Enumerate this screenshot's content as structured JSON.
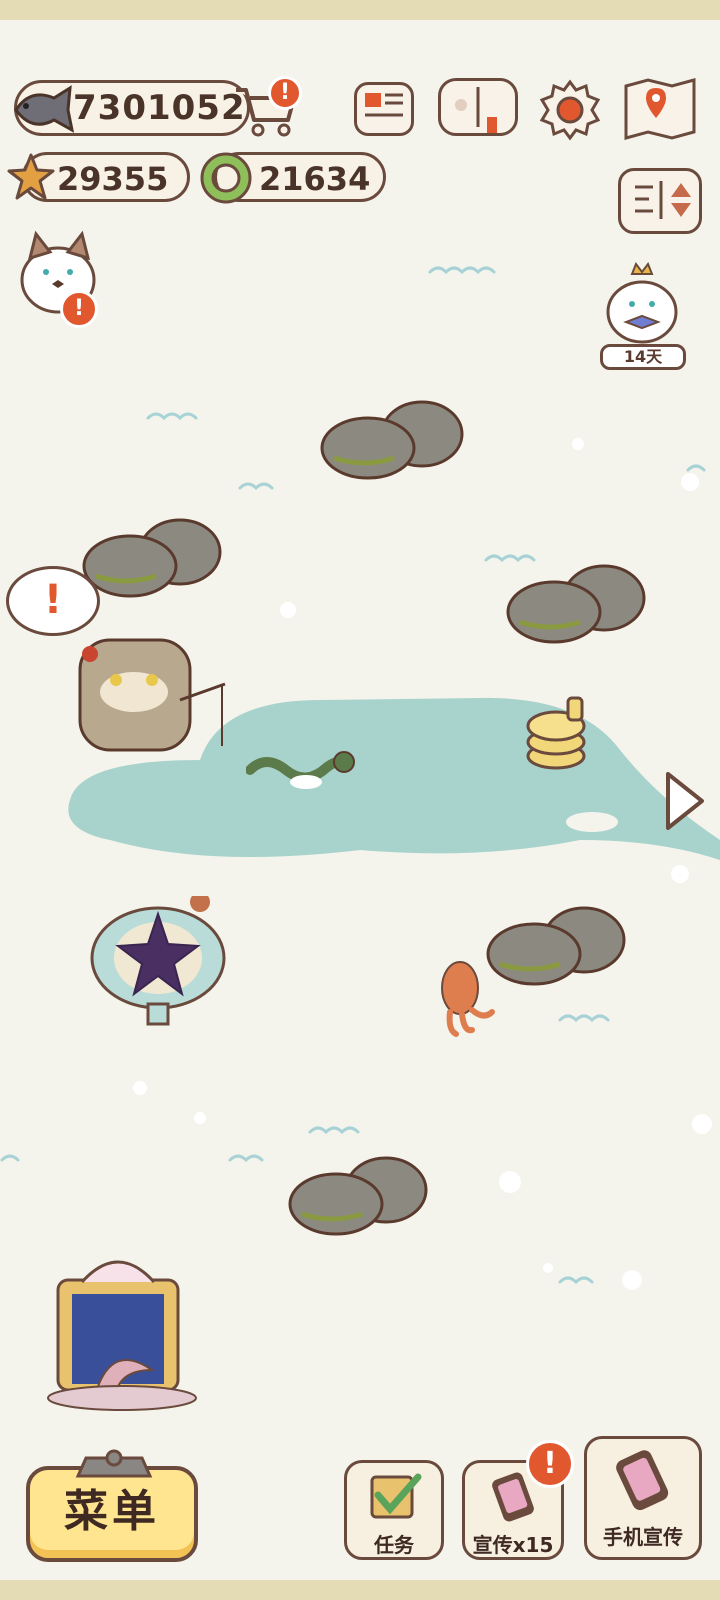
{
  "currencies": {
    "fish": "7301052",
    "star": "29355",
    "ring": "21634"
  },
  "top_icons": [
    "cart-icon",
    "newspaper-icon",
    "catalog-book-icon",
    "settings-gear-icon",
    "map-icon",
    "sort-toggle-icon"
  ],
  "event": {
    "days_label": "14天"
  },
  "speech": {
    "mark": "!"
  },
  "buttons": {
    "menu": "菜单",
    "tasks": "任务",
    "promo": "宣传x15",
    "phone_promo": "手机宣传",
    "badge_mark": "!"
  },
  "colors": {
    "background": "#f4f4ec",
    "pond": "#a8d3cc",
    "outline": "#6a4a3c",
    "badge": "#e1582f",
    "menu_button": "#ffe58f"
  }
}
